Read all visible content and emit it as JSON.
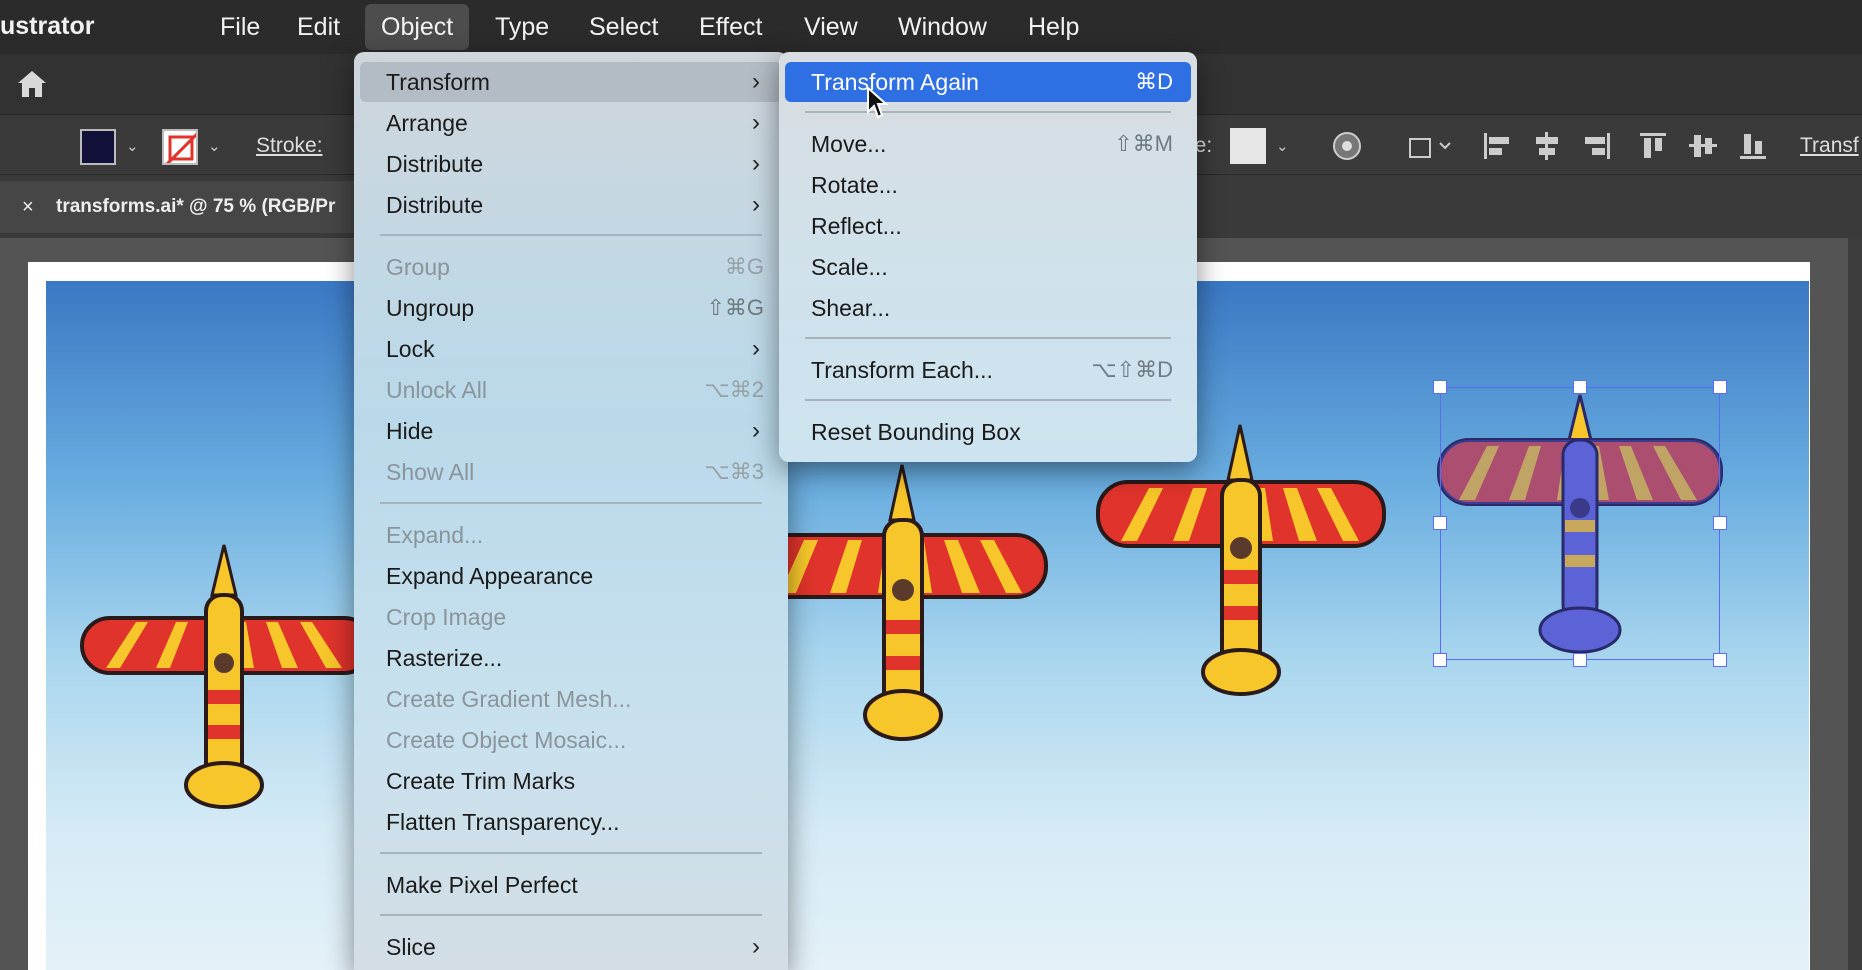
{
  "menubar": {
    "app_name": "ustrator",
    "items": [
      "File",
      "Edit",
      "Object",
      "Type",
      "Select",
      "Effect",
      "View",
      "Window",
      "Help"
    ],
    "active": "Object"
  },
  "control_bar": {
    "stroke_label": "Stroke:",
    "style_label": "le:",
    "transform_label": "Transf",
    "fill_color": "#11113a"
  },
  "document_tab": {
    "close": "×",
    "title": "transforms.ai* @ 75 % (RGB/Pr"
  },
  "object_menu": {
    "items": [
      {
        "label": "Transform",
        "submenu": true,
        "highlighted": true
      },
      {
        "label": "Arrange",
        "submenu": true
      },
      {
        "label": "Distribute",
        "submenu": true
      },
      {
        "label": "Distribute",
        "submenu": true
      },
      {
        "separator": true
      },
      {
        "label": "Group",
        "shortcut": "⌘G",
        "disabled": true
      },
      {
        "label": "Ungroup",
        "shortcut": "⇧⌘G"
      },
      {
        "label": "Lock",
        "submenu": true
      },
      {
        "label": "Unlock All",
        "shortcut": "⌥⌘2",
        "disabled": true
      },
      {
        "label": "Hide",
        "submenu": true
      },
      {
        "label": "Show All",
        "shortcut": "⌥⌘3",
        "disabled": true
      },
      {
        "separator": true
      },
      {
        "label": "Expand...",
        "disabled": true
      },
      {
        "label": "Expand Appearance"
      },
      {
        "label": "Crop Image",
        "disabled": true
      },
      {
        "label": "Rasterize..."
      },
      {
        "label": "Create Gradient Mesh...",
        "disabled": true
      },
      {
        "label": "Create Object Mosaic...",
        "disabled": true
      },
      {
        "label": "Create Trim Marks"
      },
      {
        "label": "Flatten Transparency..."
      },
      {
        "separator": true
      },
      {
        "label": "Make Pixel Perfect"
      },
      {
        "separator": true
      },
      {
        "label": "Slice",
        "submenu": true
      }
    ]
  },
  "transform_submenu": {
    "items": [
      {
        "label": "Transform Again",
        "shortcut": "⌘D",
        "selected": true
      },
      {
        "separator": true
      },
      {
        "label": "Move...",
        "shortcut": "⇧⌘M"
      },
      {
        "label": "Rotate..."
      },
      {
        "label": "Reflect..."
      },
      {
        "label": "Scale..."
      },
      {
        "label": "Shear..."
      },
      {
        "separator": true
      },
      {
        "label": "Transform Each...",
        "shortcut": "⌥⇧⌘D"
      },
      {
        "separator": true
      },
      {
        "label": "Reset Bounding Box"
      }
    ]
  },
  "icons": {
    "home": "home-icon",
    "submenu_arrow": "chevron-right-icon",
    "cursor": "arrow-cursor-icon"
  },
  "colors": {
    "menu_highlight_blue": "#2e6fe3",
    "plane_red": "#e0332b",
    "plane_yellow": "#f6c62a",
    "selected_plane_blue": "#5b63d6",
    "selection_color": "#5a6df0"
  }
}
